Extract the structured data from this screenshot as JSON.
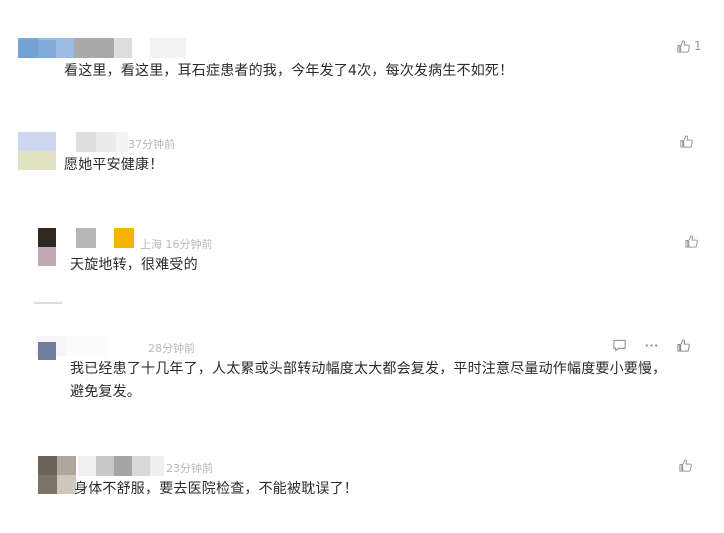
{
  "comments": [
    {
      "text": "看这里，看这里，耳石症患者的我，今年发了4次，每次发病生不如死！",
      "like_count": "1"
    },
    {
      "meta": "37分钟前",
      "text": "愿她平安健康！"
    },
    {
      "meta": "上海 16分钟前",
      "text": "天旋地转，很难受的"
    },
    {
      "meta": "28分钟前",
      "text_line1": "我已经患了十几年了，人太累或头部转动幅度太大都会复发，平时注意尽量动作幅度要小要慢，",
      "text_line2": "避免复发。"
    },
    {
      "meta": "23分钟前",
      "text": "身体不舒服，要去医院检查，不能被耽误了！"
    }
  ],
  "icons": {
    "like": "thumbs-up-icon",
    "reply": "comment-icon",
    "more": "more-icon"
  },
  "colors": {
    "text": "#2b2b2b",
    "meta": "#b8b8b8",
    "icon": "#9a9a9a"
  }
}
